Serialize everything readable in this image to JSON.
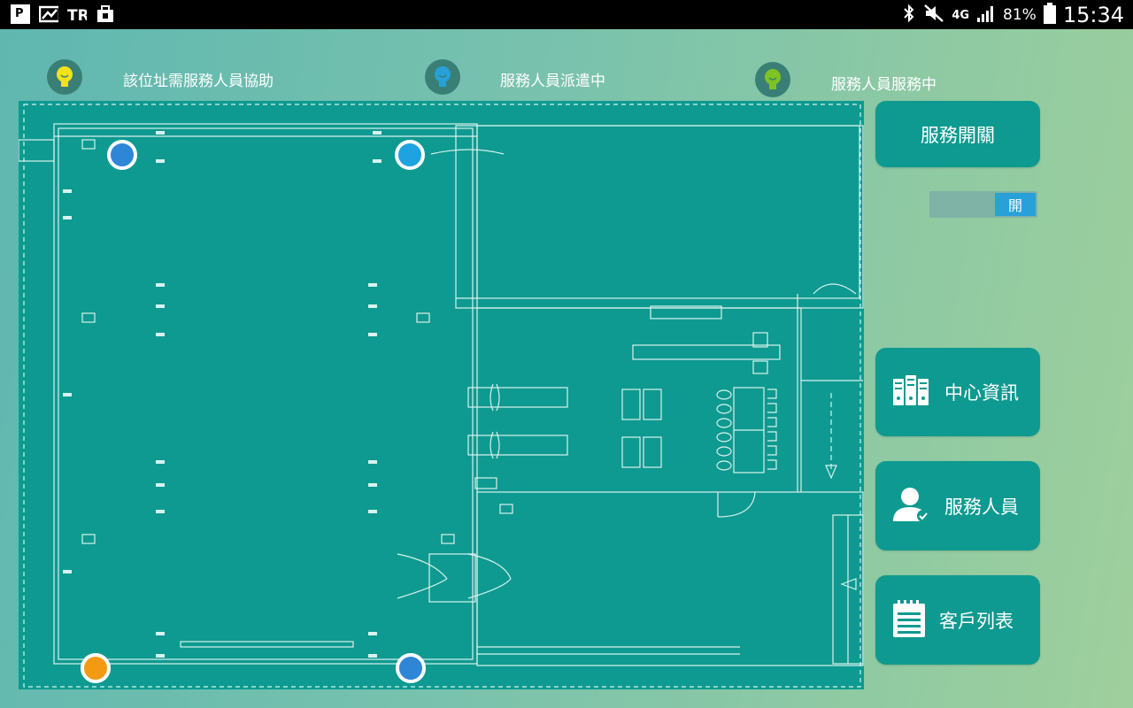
{
  "status_bar": {
    "battery": "81%",
    "network": "4G",
    "time": "15:34",
    "left_icons": [
      "p-smart-icon",
      "gallery-icon",
      "tr-icon",
      "bag-icon"
    ],
    "right_icons": [
      "bluetooth-icon",
      "mute-icon",
      "signal-icon",
      "battery-icon"
    ]
  },
  "legend": [
    {
      "label": "該位址需服務人員協助",
      "color": "#f2e21a"
    },
    {
      "label": "服務人員派遣中",
      "color": "#27a1d8"
    },
    {
      "label": "服務人員服務中",
      "color": "#7ec321"
    }
  ],
  "floorplan": {
    "markers": [
      {
        "color": "#2f86d6"
      },
      {
        "color": "#1ea3e0"
      },
      {
        "color": "#f39a12"
      },
      {
        "color": "#2f86d6"
      }
    ]
  },
  "panel": {
    "service_switch_label": "服務開關",
    "toggle_state": "開",
    "center_info_label": "中心資訊",
    "staff_label": "服務人員",
    "customer_list_label": "客戶列表"
  }
}
